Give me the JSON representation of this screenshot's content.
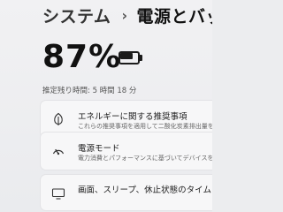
{
  "breadcrumb": {
    "parent": "システム",
    "separator": "›",
    "current": "電源とバッテリー"
  },
  "battery": {
    "percent_text": "87%",
    "level": 0.87,
    "icon": "battery-icon",
    "remaining": "推定残り時間: 5 時間 18 分"
  },
  "cards": [
    {
      "icon": "leaf-icon",
      "title": "エネルギーに関する推奨事項",
      "description": "これらの推奨事項を適用して二酸化炭素排出量を"
    },
    {
      "icon": "power-mode-icon",
      "title": "電源モード",
      "description": "電力消費とパフォーマンスに基づいてデバイスを最適化"
    },
    {
      "icon": "screen-sleep-icon",
      "title": "画面、スリープ、休止状態のタイムアウト",
      "description": ""
    }
  ],
  "colors": {
    "background": "#ecedef",
    "card": "#f7f7f8",
    "text": "#1b1b1b"
  }
}
